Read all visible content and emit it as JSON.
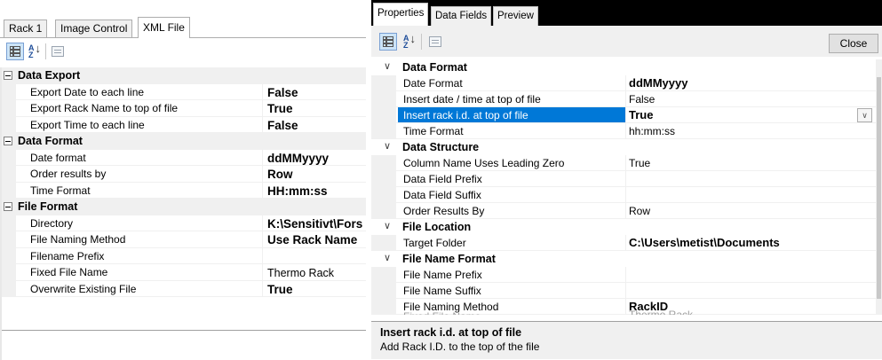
{
  "left": {
    "tabs": [
      "Rack 1",
      "Image Control",
      "XML File"
    ],
    "categories": [
      {
        "name": "Data Export",
        "props": [
          {
            "name": "Export Date to each line",
            "value": "False",
            "bold": true
          },
          {
            "name": "Export Rack Name to top of file",
            "value": "True",
            "bold": true
          },
          {
            "name": "Export Time to each line",
            "value": "False",
            "bold": true
          }
        ]
      },
      {
        "name": "Data Format",
        "props": [
          {
            "name": "Date format",
            "value": "ddMMyyyy",
            "bold": true
          },
          {
            "name": "Order results by",
            "value": "Row",
            "bold": true
          },
          {
            "name": "Time Format",
            "value": "HH:mm:ss",
            "bold": true
          }
        ]
      },
      {
        "name": "File Format",
        "props": [
          {
            "name": "Directory",
            "value": "K:\\Sensitivt\\Fors",
            "bold": true
          },
          {
            "name": "File Naming Method",
            "value": "Use Rack Name",
            "bold": true
          },
          {
            "name": "Filename Prefix",
            "value": "",
            "bold": false
          },
          {
            "name": "Fixed File Name",
            "value": "Thermo Rack",
            "bold": false
          },
          {
            "name": "Overwrite Existing File",
            "value": "True",
            "bold": true
          }
        ]
      }
    ]
  },
  "right": {
    "tabs": [
      "Properties",
      "Data Fields",
      "Preview"
    ],
    "close_label": "Close",
    "categories": [
      {
        "name": "Data Format",
        "props": [
          {
            "name": "Date Format",
            "value": "ddMMyyyy",
            "bold": true
          },
          {
            "name": "Insert date / time at top of file",
            "value": "False",
            "bold": false
          },
          {
            "name": "Insert rack i.d. at top of file",
            "value": "True",
            "bold": true,
            "selected": true
          },
          {
            "name": "Time Format",
            "value": "hh:mm:ss",
            "bold": false
          }
        ]
      },
      {
        "name": "Data Structure",
        "props": [
          {
            "name": "Column Name Uses Leading Zero",
            "value": "True",
            "bold": false
          },
          {
            "name": "Data Field Prefix",
            "value": "",
            "bold": false
          },
          {
            "name": "Data Field Suffix",
            "value": "",
            "bold": false
          },
          {
            "name": "Order Results By",
            "value": "Row",
            "bold": false
          }
        ]
      },
      {
        "name": "File Location",
        "props": [
          {
            "name": "Target Folder",
            "value": "C:\\Users\\metist\\Documents",
            "bold": true
          }
        ]
      },
      {
        "name": "File Name Format",
        "props": [
          {
            "name": "File Name Prefix",
            "value": "",
            "bold": false
          },
          {
            "name": "File Name Suffix",
            "value": "",
            "bold": false
          },
          {
            "name": "File Naming Method",
            "value": "RackID",
            "bold": true
          },
          {
            "name": "Fixed File Name",
            "value": "Thermo Rack",
            "bold": false,
            "partial": true
          }
        ]
      }
    ],
    "description": {
      "title": "Insert rack i.d. at top of file",
      "text": "Add Rack I.D. to the top of the file"
    }
  }
}
